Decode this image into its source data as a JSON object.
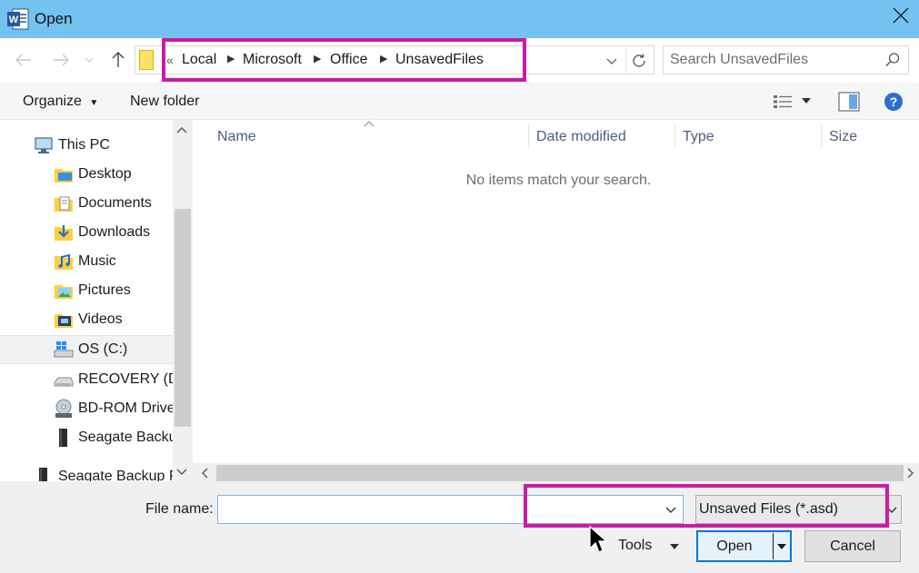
{
  "window": {
    "title": "Open",
    "app_icon": "word-icon",
    "accent_color": "#73c2f0"
  },
  "address": {
    "overflow_marker": "«",
    "crumbs": [
      "Local",
      "Microsoft",
      "Office",
      "UnsavedFiles"
    ]
  },
  "search": {
    "placeholder": "Search UnsavedFiles"
  },
  "toolbar": {
    "organize_label": "Organize",
    "new_folder_label": "New folder"
  },
  "nav": {
    "items": [
      {
        "label": "This PC",
        "icon": "computer-icon"
      },
      {
        "label": "Desktop",
        "icon": "desktop-folder-icon"
      },
      {
        "label": "Documents",
        "icon": "documents-folder-icon"
      },
      {
        "label": "Downloads",
        "icon": "downloads-folder-icon"
      },
      {
        "label": "Music",
        "icon": "music-folder-icon"
      },
      {
        "label": "Pictures",
        "icon": "pictures-folder-icon"
      },
      {
        "label": "Videos",
        "icon": "videos-folder-icon"
      },
      {
        "label": "OS (C:)",
        "icon": "windows-drive-icon",
        "selected": true
      },
      {
        "label": "RECOVERY (D:)",
        "icon": "drive-icon"
      },
      {
        "label": "BD-ROM Drive",
        "icon": "optical-drive-icon"
      },
      {
        "label": "Seagate Backup",
        "icon": "external-drive-icon"
      },
      {
        "label": "Seagate Backup P",
        "icon": "external-drive-icon"
      }
    ]
  },
  "file_list": {
    "columns": [
      "Name",
      "Date modified",
      "Type",
      "Size"
    ],
    "empty_message": "No items match your search."
  },
  "bottom": {
    "filename_label": "File name:",
    "filename_value": "",
    "filetype_value": "Unsaved Files (*.asd)",
    "tools_label": "Tools",
    "open_label": "Open",
    "cancel_label": "Cancel"
  },
  "highlight_color": "#cc1aa6"
}
